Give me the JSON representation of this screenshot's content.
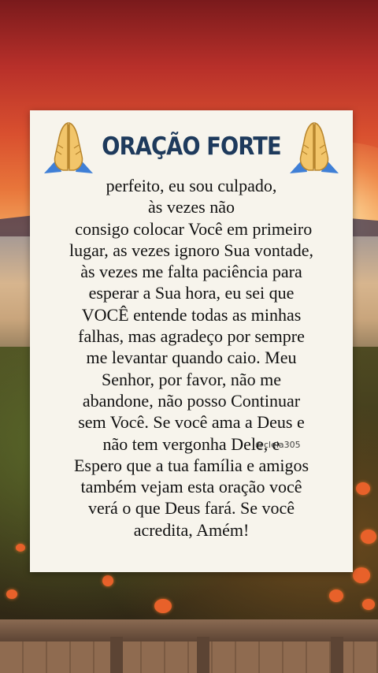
{
  "title": "ORAÇÃO FORTE",
  "lines": [
    "perfeito, eu sou culpado,",
    "às vezes não",
    " consigo colocar Você em primeiro",
    "lugar, as vezes ignoro Sua vontade,",
    "às vezes me falta paciência para",
    "esperar a Sua hora, eu sei que",
    "VOCÊ entende todas as minhas",
    "falhas, mas agradeço por sempre",
    "me levantar quando caio. Meu",
    "Senhor, por favor, não me",
    "abandone, não posso Continuar",
    "sem Você. Se você ama a Deus e",
    "não tem vergonha Dele, e",
    "Espero que a tua família e amigos",
    "também vejam esta oração você",
    "verá o que Deus fará. Se você",
    "acredita, Amém!"
  ],
  "watermark": "@cleia305",
  "icons": {
    "left": "praying-hands-icon",
    "right": "praying-hands-icon"
  },
  "colors": {
    "title": "#1e3a5c",
    "card": "#f7f4ec",
    "text": "#111111"
  }
}
